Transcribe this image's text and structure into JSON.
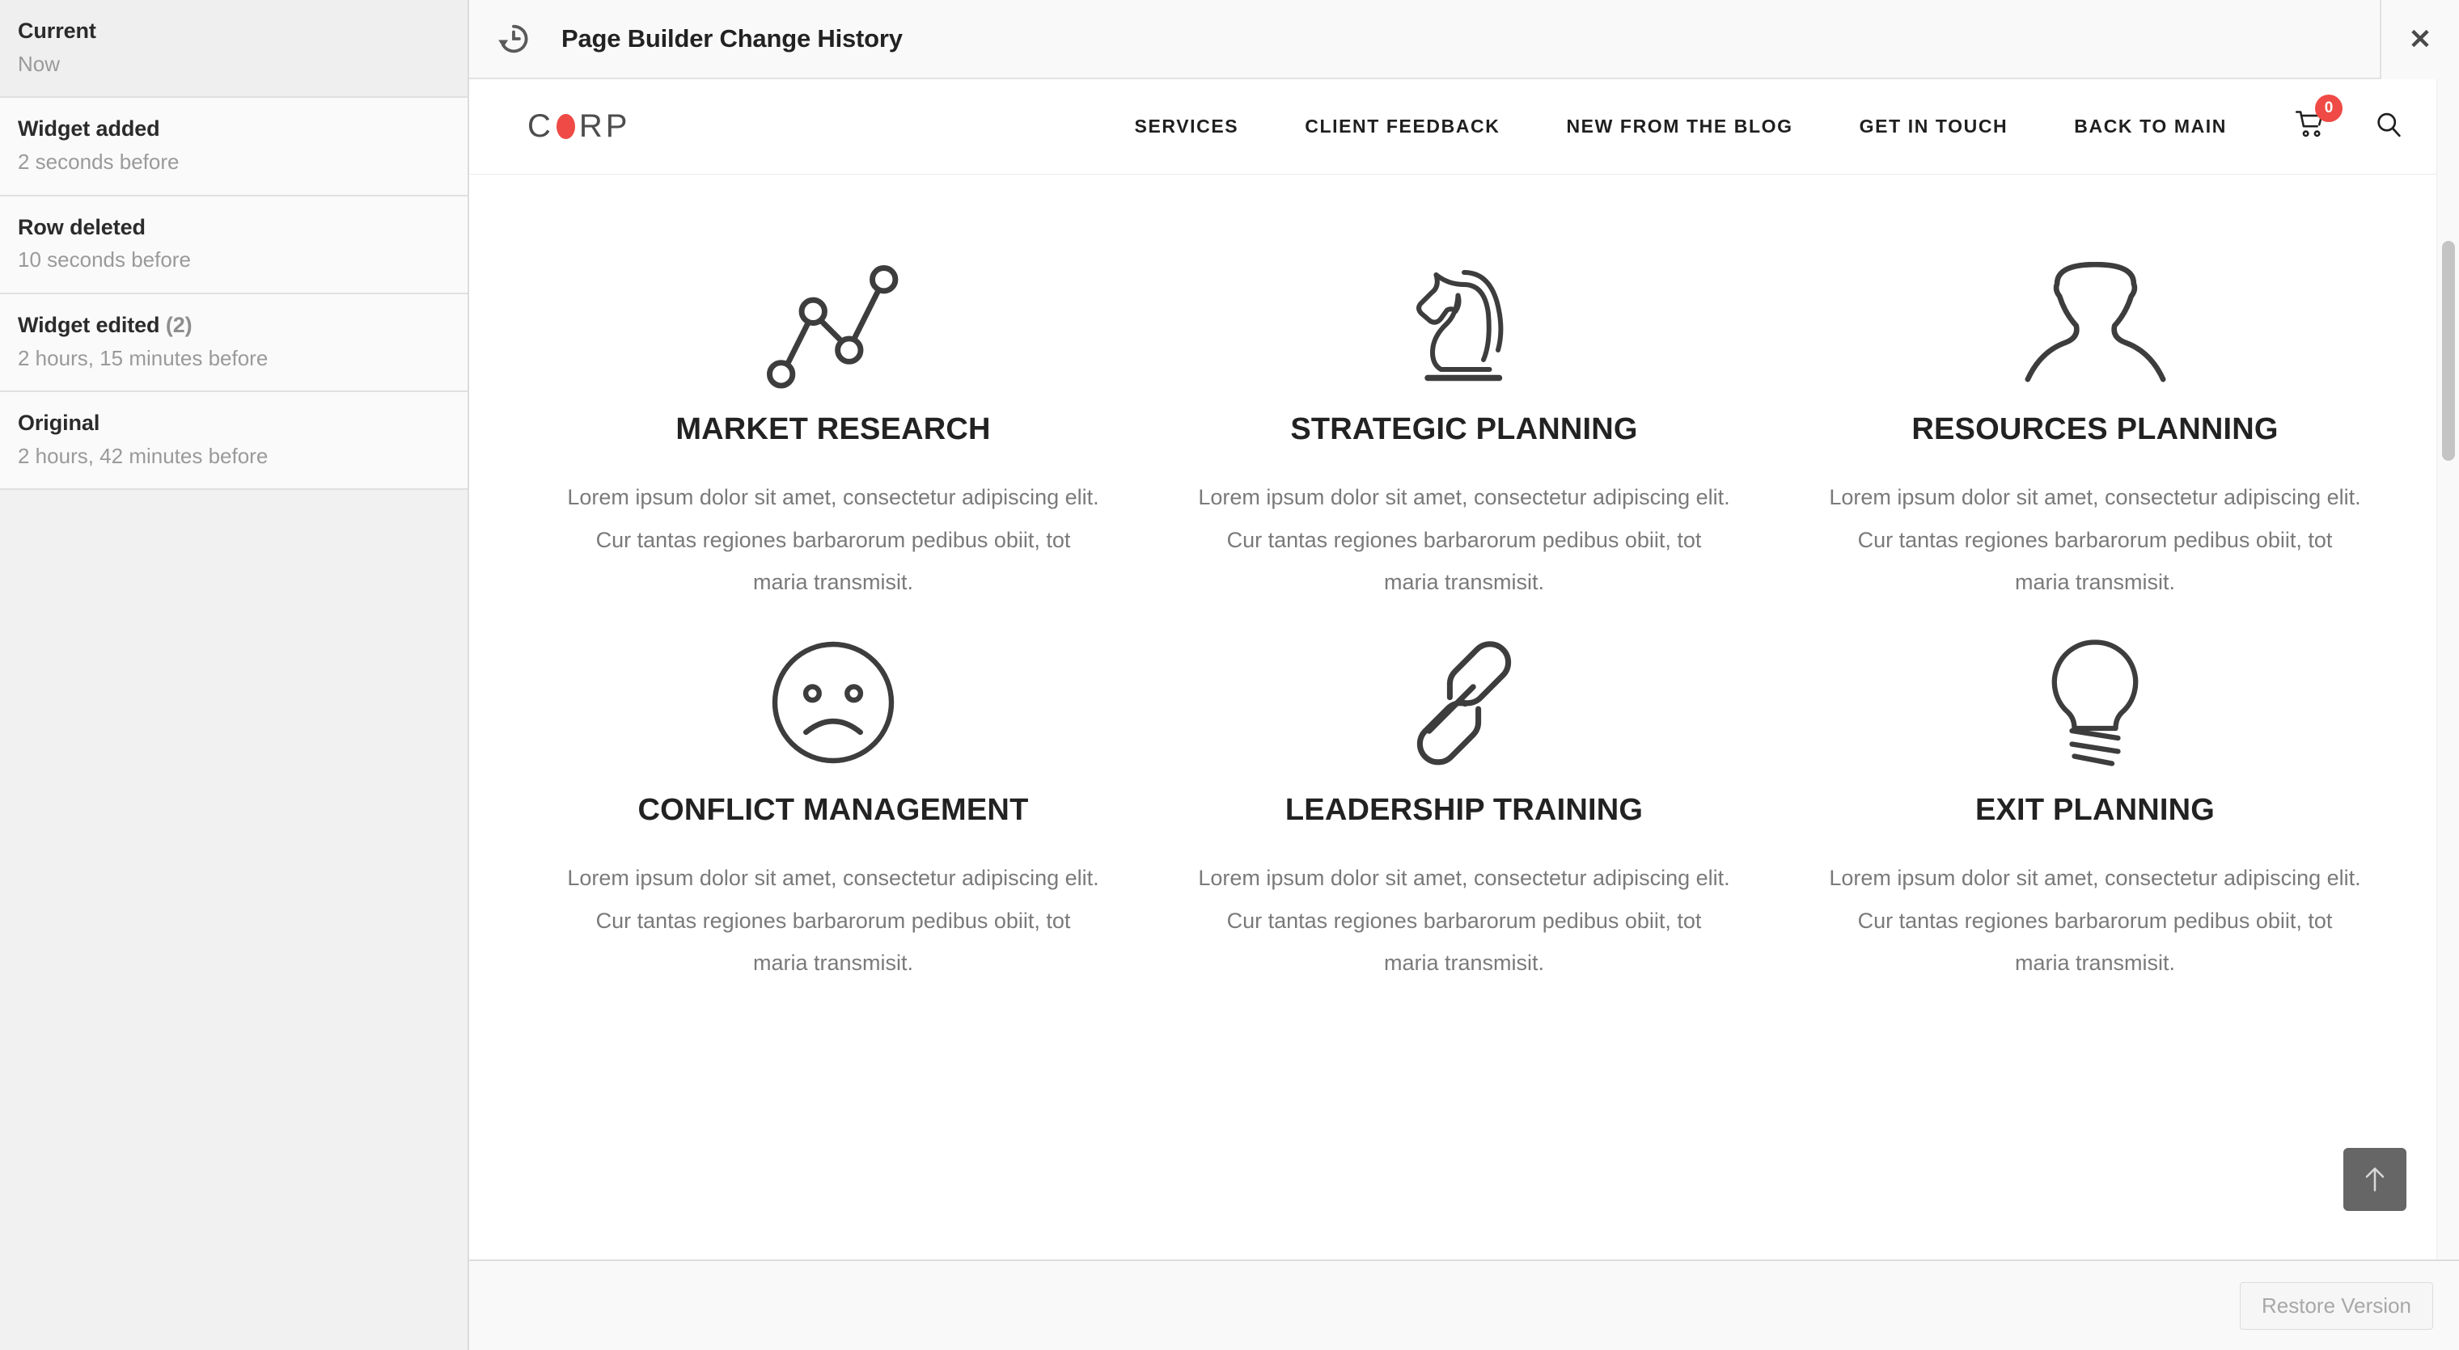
{
  "sidebar": {
    "items": [
      {
        "title": "Current",
        "count": "",
        "time": "Now",
        "active": true
      },
      {
        "title": "Widget added",
        "count": "",
        "time": "2 seconds before",
        "active": false
      },
      {
        "title": "Row deleted",
        "count": "",
        "time": "10 seconds before",
        "active": false
      },
      {
        "title": "Widget edited",
        "count": "(2)",
        "time": "2 hours, 15 minutes before",
        "active": false
      },
      {
        "title": "Original",
        "count": "",
        "time": "2 hours, 42 minutes before",
        "active": false
      }
    ]
  },
  "topbar": {
    "icon": "history-restore-icon",
    "title": "Page Builder Change History",
    "close_icon": "close-icon",
    "close_label": "✕"
  },
  "site_nav": {
    "logo": {
      "before": "C",
      "dot": "o",
      "after": "RP"
    },
    "links": [
      {
        "label": "SERVICES"
      },
      {
        "label": "CLIENT FEEDBACK"
      },
      {
        "label": "NEW FROM THE BLOG"
      },
      {
        "label": "GET IN TOUCH"
      },
      {
        "label": "BACK TO MAIN"
      }
    ],
    "cart": {
      "icon": "shopping-cart-icon",
      "badge": "0"
    },
    "search": {
      "icon": "search-icon"
    }
  },
  "services": [
    {
      "icon": "line-chart-icon",
      "title": "MARKET RESEARCH",
      "body": "Lorem ipsum dolor sit amet, consectetur adipiscing elit. Cur tantas regiones barbarorum pedibus obiit, tot maria transmisit."
    },
    {
      "icon": "chess-knight-icon",
      "title": "STRATEGIC PLANNING",
      "body": "Lorem ipsum dolor sit amet, consectetur adipiscing elit. Cur tantas regiones barbarorum pedibus obiit, tot maria transmisit."
    },
    {
      "icon": "person-silhouette-icon",
      "title": "RESOURCES PLANNING",
      "body": "Lorem ipsum dolor sit amet, consectetur adipiscing elit. Cur tantas regiones barbarorum pedibus obiit, tot maria transmisit."
    },
    {
      "icon": "sad-face-icon",
      "title": "CONFLICT MANAGEMENT",
      "body": "Lorem ipsum dolor sit amet, consectetur adipiscing elit. Cur tantas regiones barbarorum pedibus obiit, tot maria transmisit."
    },
    {
      "icon": "chain-link-icon",
      "title": "LEADERSHIP TRAINING",
      "body": "Lorem ipsum dolor sit amet, consectetur adipiscing elit. Cur tantas regiones barbarorum pedibus obiit, tot maria transmisit."
    },
    {
      "icon": "lightbulb-icon",
      "title": "EXIT PLANNING",
      "body": "Lorem ipsum dolor sit amet, consectetur adipiscing elit. Cur tantas regiones barbarorum pedibus obiit, tot maria transmisit."
    }
  ],
  "scroll_top": {
    "icon": "arrow-up-icon"
  },
  "footer": {
    "restore_label": "Restore Version"
  },
  "colors": {
    "accent_red": "#ef4a45",
    "sidebar_bg": "#f1f1f1",
    "item_bg": "#fafafa",
    "item_active_bg": "#efefef",
    "topbar_bg": "#f9f9f9",
    "text_dark": "#222222",
    "text_muted": "#9a9a9a",
    "icon_stroke": "#404040",
    "scrolltop_bg": "#666666"
  }
}
